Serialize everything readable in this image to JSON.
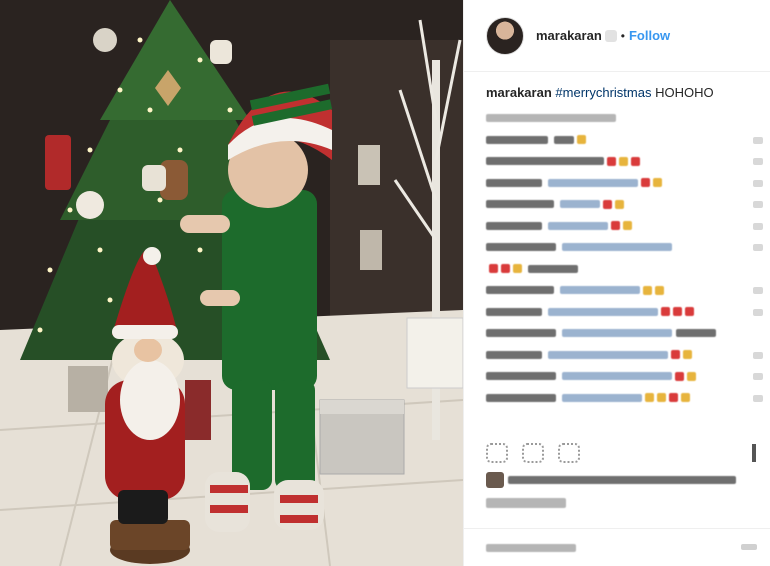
{
  "post": {
    "username": "marakaran",
    "follow_label": "Follow",
    "separator": "•",
    "caption_user": "marakaran",
    "caption_hashtag": "#merrychristmas",
    "caption_text": "HOHOHO"
  },
  "icons": {
    "avatar": "profile-avatar",
    "verified": "verified-badge-icon",
    "like": "heart-icon",
    "comment": "comment-icon",
    "share": "share-icon",
    "save": "bookmark-icon",
    "more": "more-options-icon"
  },
  "colors": {
    "follow_blue": "#3897f0",
    "hashtag_blue": "#003569",
    "text": "#262626"
  }
}
